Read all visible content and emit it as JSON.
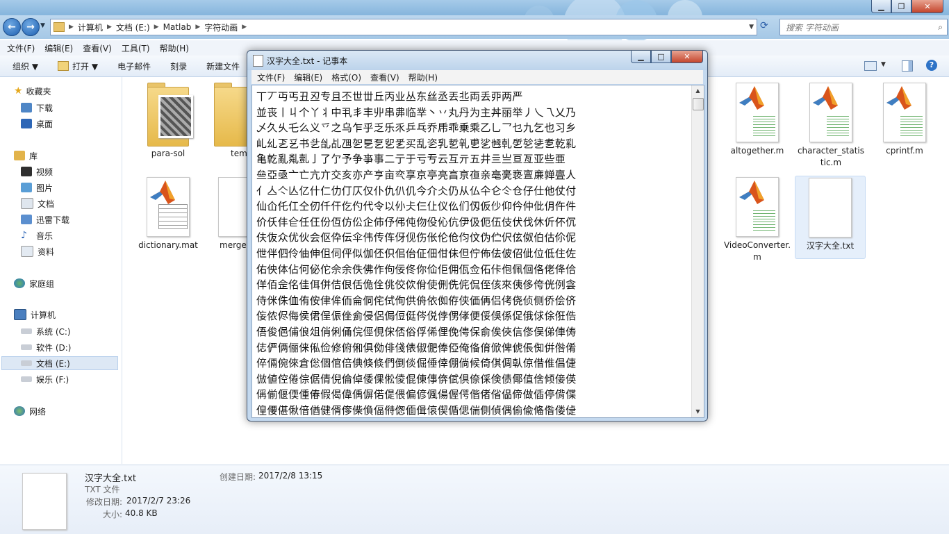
{
  "explorer": {
    "breadcrumb": [
      "计算机",
      "文档 (E:)",
      "Matlab",
      "字符动画"
    ],
    "search_placeholder": "搜索 字符动画",
    "menu": [
      "文件(F)",
      "编辑(E)",
      "查看(V)",
      "工具(T)",
      "帮助(H)"
    ],
    "toolbar": [
      "组织 ▼",
      "打开 ▼",
      "电子邮件",
      "刻录",
      "新建文件"
    ],
    "nav": {
      "favorites": "收藏夹",
      "favorites_items": [
        "下载",
        "桌面"
      ],
      "libraries": "库",
      "libraries_items": [
        "视频",
        "图片",
        "文档",
        "迅雷下载",
        "音乐",
        "资料"
      ],
      "homegroup": "家庭组",
      "computer": "计算机",
      "computer_items": [
        "系统 (C:)",
        "软件 (D:)",
        "文档 (E:)",
        "娱乐 (F:)"
      ],
      "network": "网络"
    },
    "files": [
      {
        "name": "para-sol",
        "type": "folder"
      },
      {
        "name": "tem",
        "type": "folder"
      },
      {
        "name": "dictionary.mat",
        "type": "mat"
      },
      {
        "name": "merge",
        "type": "doc"
      },
      {
        "name": "altogether.m",
        "type": "m"
      },
      {
        "name": "character_statistic.m",
        "type": "m"
      },
      {
        "name": "cprintf.m",
        "type": "m"
      },
      {
        "name": "VideoConverter.m",
        "type": "m"
      },
      {
        "name": "汉字大全.txt",
        "type": "txt"
      }
    ],
    "details": {
      "name": "汉字大全.txt",
      "type": "TXT 文件",
      "modified_label": "修改日期:",
      "modified": "2017/2/7 23:26",
      "size_label": "大小:",
      "size": "40.8 KB",
      "created_label": "创建日期:",
      "created": "2017/2/8 13:15"
    }
  },
  "notepad": {
    "title": "汉字大全.txt - 记事本",
    "menu": [
      "文件(F)",
      "编辑(E)",
      "格式(O)",
      "查看(V)",
      "帮助(H)"
    ],
    "lines": [
      "丅丆丏丐丑丒专且丕世丗丘丙业丛东丝丞丟丠両丢丣两严",
      "並丧丨丩个丫丬中丮丯丰丱串丳临丵丶丷丸丹为主丼丽举丿乀乁乂乃",
      "乄久乆乇么义乊之乌乍乎乏乐乑乒乓乔乕乖乗乘乙乚乛乜九乞也习乡",
      "乢乣乤乥书乧乨乩乪乫乬乭乮乯买乱乲乳乴乵乶乷乸乹乺乻乼乽乾乿",
      "亀亁亂亃亄亅了亇予争亊事二亍于亏亐云互亓五井亖亗亘亙亚些亜",
      "亝亞亟亠亡亢亣交亥亦产亨亩亪享京亭亮亯亰亱亲亳亴亵亶亷亸亹人",
      "亻亼亽亾亿什仁仂仃仄仅仆仇仈仉今介仌仍从仏仐仑仒仓仔仕他仗付",
      "仙仚仛仜仝仞仟仠仡仢代令以仦仧仨仩仪仫们仭仮仯仰仱仲仳仴仵件",
      "价仸仹仺任仼份仾仿伀企伂伃伄伅伆伇伈伉伊伋伌伍伎伏伐休伒伓伔",
      "伕伖众优伙会伛伜伝伞伟传伡伢伣伤伥伦伧伨伩伪伫伬伭伮伯估伱伲",
      "伳伴伵伶伷伸伹伺伻似伽伾伿佀佁佂佃佄佅但佇佈佉佊佋佌位低住佐",
      "佑佒体佔何佖佗佘余佚佛作佝佞佟你佡佢佣佤佥佦佧佨佩佪佫佬佭佮",
      "佯佰佱佲佳佴併佶佷佸佹佺佻佼佽佾使侀侁侂侃侄侅來侇侈侉侊例侌",
      "侍侎侏侐侑侒侓侔侕侖侗侘侙侚供侜依侞侟侠価侢侣侤侥侦侧侨侩侪",
      "侫侬侭侮侯侰侱侲侳侴侵侶侷侸侹侺侻侼侽侾便俀俁係促俄俅俆俇俈",
      "俉俊俋俌俍俎俏俐俑俒俓俔俕俖俗俘俙俚俛俜保俞俟俠信俢俣俤俥俦",
      "俧俨俩俪俫俬俭修俯俰俱俲俳俴俵俶俷俸俹俺俻俼俽俾俿倀倁倂倃倄",
      "倅倆倇倈倉倊個倌倍倎倏倐們倒倓倔倕倖倗倘候倚倛倜倝倞借倠倡倢",
      "倣値倥倦倧倨倩倪倫倬倭倮倯倰倱倲倳倴倵倶倷倸倹债倻值倽倾倿偀",
      "偁偂偃偄偅偆假偈偉偊偋偌偍偎偏偐偑偒偓偔偕偖偗偘偙做偛停偝偞",
      "偟偠偡偢偣偤健偦偧偨偩偪偫偬偭偮偯偰偱偲偳側偵偶偷偸偹偺偻偼",
      "偽偾偿傀傁傂傃傄傅傆傇傈傉傊傋傌傍傎傏傐傑傒傓傔傕傖傗傘備傚",
      "傛傜傝傞傟傠傡傢傣傤傥傦傧储傩傪傫催傭傮傯傰傱傲傳傴債傶傷傸",
      "傹傺傻傼傽傾傿僀僁僂僃僄僅僆僇僈僉僊僋僌働僎像僐僑僒僓僔僕僖",
      "僗僘僙僚僛僜僝僞僟僠僡僢僣僤僥僦僧僨僩僪僫僬僭僮僯僰僱僲僳僴",
      "僵僶僷僸價僺僻僼僽僾僿儀儁儂儃億儅儆儇儈儉儊儋儌儍儎儏儐儑儒",
      "儓儔儕儖儗儘儙儚儛儜儝儞償儠儡儢儣儤儥儦儧儨儩優儫儬儭儮儯儰",
      "儱儲儳儴儵儶儷儸儹儺儻儼儽儾儿兀允兂元"
    ]
  }
}
